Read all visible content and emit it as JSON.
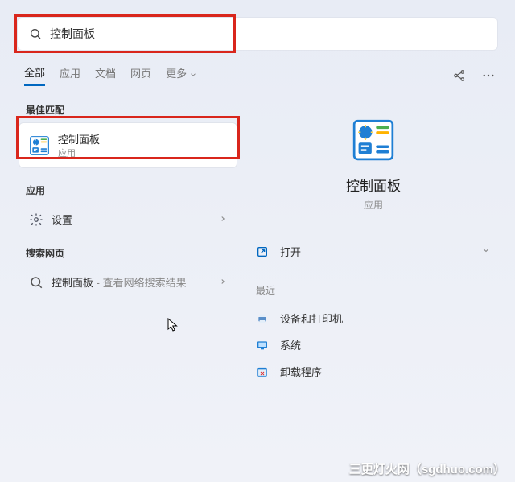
{
  "search": {
    "value": "控制面板"
  },
  "tabs": [
    "全部",
    "应用",
    "文档",
    "网页",
    "更多"
  ],
  "left": {
    "bestMatchLabel": "最佳匹配",
    "bestMatch": {
      "title": "控制面板",
      "subtitle": "应用"
    },
    "appsLabel": "应用",
    "settings": "设置",
    "searchWebLabel": "搜索网页",
    "webItem": {
      "main": "控制面板",
      "sub": " - 查看网络搜索结果"
    }
  },
  "right": {
    "title": "控制面板",
    "subtitle": "应用",
    "open": "打开",
    "recentLabel": "最近",
    "recent": [
      "设备和打印机",
      "系统",
      "卸载程序"
    ]
  },
  "watermark": "三更灯火网（sgdhuo.com）"
}
